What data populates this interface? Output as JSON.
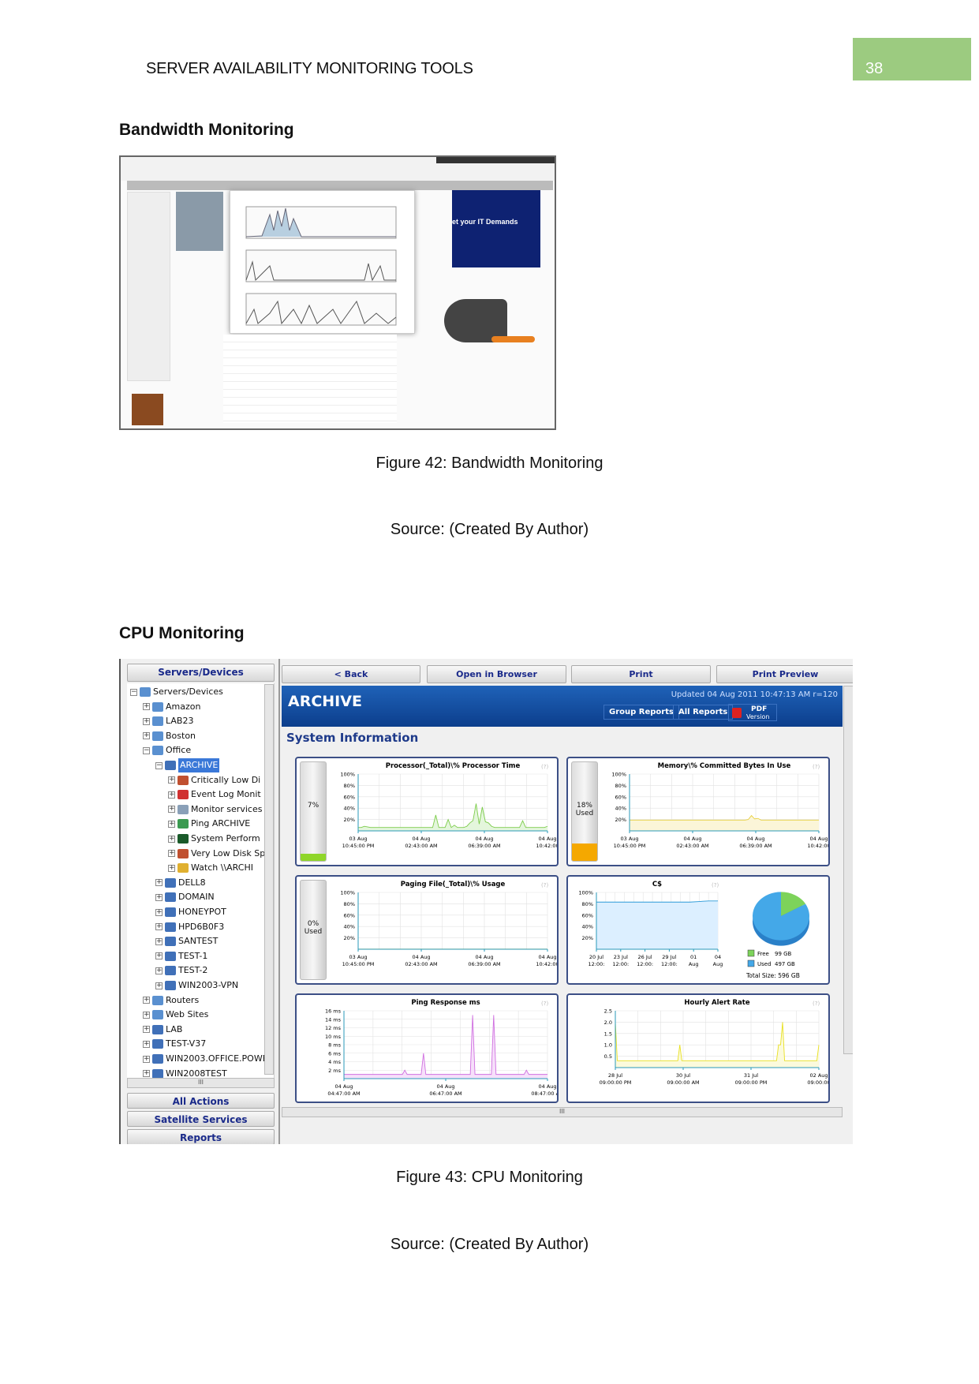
{
  "header": {
    "running_title": "SERVER AVAILABILITY MONITORING TOOLS",
    "page_number": "38",
    "page_box_color": "#9ccb80"
  },
  "section1": {
    "heading": "Bandwidth Monitoring",
    "figure_caption": "Figure 42: Bandwidth Monitoring",
    "source": "Source: (Created By Author)",
    "ad_text": "et your IT Demands"
  },
  "section2": {
    "heading": "CPU  Monitoring",
    "figure_caption": "Figure 43: CPU Monitoring",
    "source": "Source: (Created By Author)"
  },
  "app": {
    "sidebar": {
      "title": "Servers/Devices",
      "actions": [
        "All Actions",
        "Satellite Services",
        "Reports"
      ],
      "scroll_grip": "III",
      "tree": [
        {
          "label": "Servers/Devices",
          "level": 0,
          "icon": "group-icon",
          "expanded": true
        },
        {
          "label": "Amazon",
          "level": 1,
          "icon": "group-icon"
        },
        {
          "label": "LAB23",
          "level": 1,
          "icon": "group-icon"
        },
        {
          "label": "Boston",
          "level": 1,
          "icon": "group-icon"
        },
        {
          "label": "Office",
          "level": 1,
          "icon": "group-icon",
          "expanded": true
        },
        {
          "label": "ARCHIVE",
          "level": 2,
          "icon": "server-icon",
          "expanded": true,
          "selected": true
        },
        {
          "label": "Critically Low Di",
          "level": 3,
          "icon": "disk-alert-icon"
        },
        {
          "label": "Event Log Monit",
          "level": 3,
          "icon": "event-log-icon"
        },
        {
          "label": "Monitor services",
          "level": 3,
          "icon": "services-gear-icon"
        },
        {
          "label": "Ping ARCHIVE",
          "level": 3,
          "icon": "ping-icon"
        },
        {
          "label": "System Perform",
          "level": 3,
          "icon": "performance-icon"
        },
        {
          "label": "Very Low Disk Sp",
          "level": 3,
          "icon": "disk-alert-icon"
        },
        {
          "label": "Watch \\\\ARCHI",
          "level": 3,
          "icon": "folder-watch-icon"
        },
        {
          "label": "DELL8",
          "level": 2,
          "icon": "server-icon"
        },
        {
          "label": "DOMAIN",
          "level": 2,
          "icon": "server-icon"
        },
        {
          "label": "HONEYPOT",
          "level": 2,
          "icon": "server-icon"
        },
        {
          "label": "HPD6B0F3",
          "level": 2,
          "icon": "server-icon"
        },
        {
          "label": "SANTEST",
          "level": 2,
          "icon": "server-icon"
        },
        {
          "label": "TEST-1",
          "level": 2,
          "icon": "server-icon"
        },
        {
          "label": "TEST-2",
          "level": 2,
          "icon": "server-icon"
        },
        {
          "label": "WIN2003-VPN",
          "level": 2,
          "icon": "server-icon"
        },
        {
          "label": "Routers",
          "level": 1,
          "icon": "group-icon"
        },
        {
          "label": "Web Sites",
          "level": 1,
          "icon": "group-icon"
        },
        {
          "label": "LAB",
          "level": 1,
          "icon": "server-icon"
        },
        {
          "label": "TEST-V37",
          "level": 1,
          "icon": "server-icon"
        },
        {
          "label": "WIN2003.OFFICE.POWE",
          "level": 1,
          "icon": "server-icon"
        },
        {
          "label": "WIN2008TEST",
          "level": 1,
          "icon": "server-icon"
        }
      ]
    },
    "toolbar": {
      "back": "< Back",
      "open": "Open in Browser",
      "print": "Print",
      "preview": "Print Preview"
    },
    "banner": {
      "title": "ARCHIVE",
      "updated": "Updated 04 Aug 2011 10:47:13 AM r=120",
      "group_reports": "Group Reports",
      "all_reports": "All Reports",
      "pdf": "PDF",
      "pdf_sub": "Version",
      "color": "#0c3e8c"
    },
    "section_title": "System Information",
    "help": "(?)",
    "hscroll_grip": "III"
  },
  "chart_data": [
    {
      "type": "area",
      "title": "Processor(_Total)\\% Processor Time",
      "gauge": {
        "label": "7%",
        "value": 7,
        "color": "#8fd62a"
      },
      "color": "#7ccc4a",
      "fill": "#e4f6dc",
      "yticks": [
        "100%",
        "80%",
        "60%",
        "40%",
        "20%"
      ],
      "ylim": [
        0,
        100
      ],
      "xticks": [
        [
          "03 Aug",
          "10:45:00 PM"
        ],
        [
          "04 Aug",
          "02:43:00 AM"
        ],
        [
          "04 Aug",
          "06:39:00 AM"
        ],
        [
          "04 Aug",
          "10:42:00"
        ]
      ],
      "values": [
        6,
        6,
        8,
        7,
        6,
        6,
        6,
        6,
        6,
        6,
        6,
        6,
        6,
        6,
        6,
        6,
        6,
        6,
        6,
        6,
        6,
        6,
        6,
        6,
        6,
        28,
        6,
        6,
        6,
        20,
        6,
        10,
        6,
        6,
        6,
        8,
        14,
        18,
        48,
        12,
        42,
        16,
        14,
        8,
        6,
        6,
        6,
        6,
        6,
        6,
        6,
        6,
        6,
        18,
        6,
        6,
        6,
        6,
        6,
        6,
        6,
        8
      ]
    },
    {
      "type": "area",
      "title": "Memory\\% Committed Bytes In Use",
      "gauge": {
        "label": "18%",
        "sub": "Used",
        "value": 18,
        "color": "#f5a800"
      },
      "color": "#e8d040",
      "fill": "#fbf5d8",
      "yticks": [
        "100%",
        "80%",
        "60%",
        "40%",
        "20%"
      ],
      "ylim": [
        0,
        100
      ],
      "xticks": [
        [
          "03 Aug",
          "10:45:00 PM"
        ],
        [
          "04 Aug",
          "02:43:00 AM"
        ],
        [
          "04 Aug",
          "06:39:00 AM"
        ],
        [
          "04 Aug",
          "10:42:00"
        ]
      ],
      "values": [
        19,
        19,
        19,
        19,
        19,
        19,
        19,
        19,
        19,
        19,
        19,
        19,
        19,
        19,
        19,
        19,
        19,
        19,
        19,
        19,
        19,
        19,
        19,
        19,
        19,
        19,
        19,
        19,
        19,
        19,
        19,
        19,
        19,
        19,
        19,
        19,
        19,
        20,
        27,
        21,
        22,
        19,
        19,
        19,
        19,
        19,
        19,
        19,
        19,
        19,
        19,
        19,
        19,
        19,
        19,
        19,
        19,
        19,
        19,
        19
      ]
    },
    {
      "type": "area",
      "title": "Paging File(_Total)\\% Usage",
      "gauge": {
        "label": "0%",
        "sub": "Used",
        "value": 0,
        "color": "#8fd62a"
      },
      "color": "#e8d040",
      "fill": "#fbf5d8",
      "yticks": [
        "100%",
        "80%",
        "60%",
        "40%",
        "20%"
      ],
      "ylim": [
        0,
        100
      ],
      "xticks": [
        [
          "03 Aug",
          "10:45:00 PM"
        ],
        [
          "04 Aug",
          "02:43:00 AM"
        ],
        [
          "04 Aug",
          "06:39:00 AM"
        ],
        [
          "04 Aug",
          "10:42:00"
        ]
      ],
      "values": [
        0,
        0,
        0,
        0,
        0,
        0,
        0,
        0,
        0,
        0
      ]
    },
    {
      "type": "area",
      "title": "C$",
      "color": "#2a9ad8",
      "fill": "#dcefff",
      "yticks": [
        "100%",
        "80%",
        "60%",
        "40%",
        "20%"
      ],
      "ylim": [
        0,
        100
      ],
      "xticks": [
        [
          "20 Jul",
          "12:00:"
        ],
        [
          "23 Jul",
          "12:00:"
        ],
        [
          "26 Jul",
          "12:00:"
        ],
        [
          "29 Jul",
          "12:00:"
        ],
        [
          "01",
          "Aug"
        ],
        [
          "04",
          "Aug"
        ]
      ],
      "values": [
        83,
        83,
        83,
        83,
        83,
        83,
        83,
        83,
        83,
        83,
        83,
        84,
        85,
        85
      ],
      "pie": {
        "slices": [
          {
            "label": "Free",
            "value": 99,
            "text": "99 GB",
            "color": "#7dd35a"
          },
          {
            "label": "Used",
            "value": 497,
            "text": "497 GB",
            "color": "#44a8e8"
          }
        ],
        "total": "Total Size: 596 GB"
      }
    },
    {
      "type": "area",
      "title": "Ping Response ms",
      "color": "#d070e0",
      "fill": "#f6e0fa",
      "yticks": [
        "16 ms",
        "14 ms",
        "12 ms",
        "10 ms",
        "8 ms",
        "6 ms",
        "4 ms",
        "2 ms"
      ],
      "ylim": [
        0,
        16
      ],
      "xticks": [
        [
          "04 Aug",
          "04:47:00 AM"
        ],
        [
          "04 Aug",
          "06:47:00 AM"
        ],
        [
          "04 Aug",
          "08:47:00 AM"
        ]
      ],
      "values": [
        1,
        1,
        1,
        1,
        1,
        1,
        1,
        1,
        1,
        1,
        1,
        1,
        1,
        1,
        1,
        1,
        1,
        1,
        1,
        1,
        1,
        1,
        1,
        1,
        1,
        1,
        2,
        1,
        1,
        1,
        1,
        1,
        1,
        1,
        6,
        1,
        1,
        1,
        1,
        1,
        1,
        1,
        1,
        1,
        1,
        1,
        1,
        1,
        1,
        1,
        1,
        1,
        1,
        1,
        1,
        15,
        1,
        1,
        1,
        1,
        1,
        1,
        1,
        1,
        15,
        1,
        1,
        1,
        1,
        1,
        1,
        1,
        1,
        1,
        1,
        1,
        1,
        1,
        2,
        1,
        1,
        1,
        1,
        1,
        1,
        1,
        1,
        1
      ]
    },
    {
      "type": "area",
      "title": "Hourly Alert Rate",
      "color": "#e8e020",
      "fill": "#fbfadc",
      "yticks": [
        "2.5",
        "2.0",
        "1.5",
        "1.0",
        "0.5"
      ],
      "ylim": [
        0,
        2.5
      ],
      "xticks": [
        [
          "28 Jul",
          "09:00:00 PM"
        ],
        [
          "30 Jul",
          "09:00:00 AM"
        ],
        [
          "31 Jul",
          "09:00:00 PM"
        ],
        [
          "02 Aug",
          "09:00:00"
        ]
      ],
      "values": [
        2,
        0,
        0,
        0,
        0,
        0,
        0,
        0,
        0,
        0,
        0,
        0,
        0,
        0,
        0,
        0,
        0,
        0,
        0,
        0,
        0,
        0,
        0,
        0,
        0,
        0,
        0,
        0,
        0,
        0,
        0,
        0,
        1,
        0,
        0,
        0,
        0,
        0,
        0,
        0,
        0,
        0,
        0,
        0,
        0,
        0,
        0,
        0,
        0,
        0,
        0,
        0,
        0,
        0,
        0,
        0,
        0,
        0,
        0,
        0,
        0,
        0,
        0,
        0,
        0,
        0,
        0,
        0,
        0,
        0,
        0,
        0,
        0,
        0,
        0,
        0,
        0,
        0,
        0,
        0,
        0,
        1,
        1,
        2,
        0,
        0,
        0,
        0,
        0,
        0,
        0,
        0,
        0,
        0,
        0,
        0,
        0,
        0,
        0,
        0,
        0,
        1
      ]
    }
  ]
}
